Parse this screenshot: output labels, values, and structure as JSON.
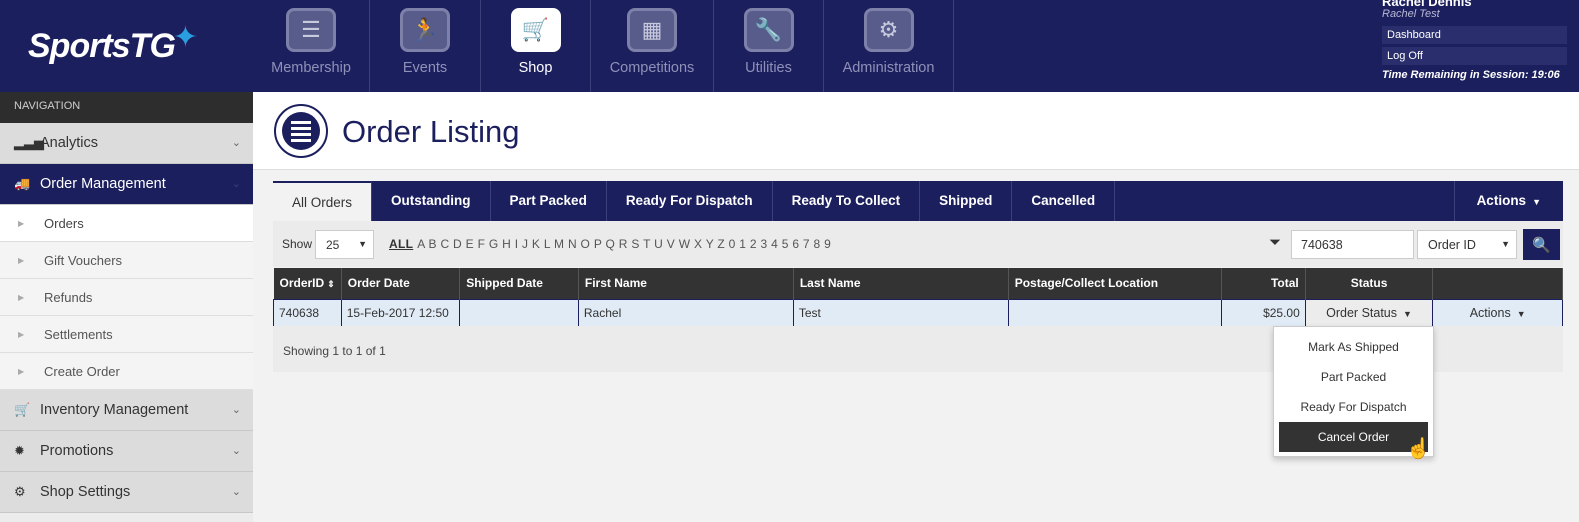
{
  "header": {
    "logo": "SportsTG",
    "modules": [
      {
        "label": "Membership",
        "icon": "clipboard-icon",
        "glyph": "☰",
        "active": false,
        "width": 117
      },
      {
        "label": "Events",
        "icon": "runner-icon",
        "glyph": "🏃",
        "active": false,
        "width": 111
      },
      {
        "label": "Shop",
        "icon": "cart-icon",
        "glyph": "🛒",
        "active": true,
        "width": 110
      },
      {
        "label": "Competitions",
        "icon": "podium-icon",
        "glyph": "▦",
        "active": false,
        "width": 123
      },
      {
        "label": "Utilities",
        "icon": "wrench-icon",
        "glyph": "🔧",
        "active": false,
        "width": 110
      },
      {
        "label": "Administration",
        "icon": "gear-icon",
        "glyph": "⚙",
        "active": false,
        "width": 130
      }
    ],
    "user": {
      "name": "Rachel Dennis",
      "sub": "Rachel Test",
      "links": [
        "Dashboard",
        "Log Off"
      ],
      "session": "Time Remaining in Session: 19:06"
    }
  },
  "sidebar": {
    "title": "NAVIGATION",
    "sections": [
      {
        "label": "Analytics",
        "icon": "bar-chart-icon",
        "glyph": "▂▃▅",
        "open": false
      },
      {
        "label": "Order Management",
        "icon": "truck-icon",
        "glyph": "🚚",
        "open": true,
        "items": [
          {
            "label": "Orders",
            "active": true
          },
          {
            "label": "Gift Vouchers",
            "active": false
          },
          {
            "label": "Refunds",
            "active": false
          },
          {
            "label": "Settlements",
            "active": false
          },
          {
            "label": "Create Order",
            "active": false
          }
        ]
      },
      {
        "label": "Inventory Management",
        "icon": "cart-icon",
        "glyph": "🛒",
        "open": false
      },
      {
        "label": "Promotions",
        "icon": "badge-icon",
        "glyph": "✹",
        "open": false
      },
      {
        "label": "Shop Settings",
        "icon": "cogs-icon",
        "glyph": "⚙",
        "open": false
      }
    ]
  },
  "page": {
    "title": "Order Listing"
  },
  "tabs": [
    "All Orders",
    "Outstanding",
    "Part Packed",
    "Ready For Dispatch",
    "Ready To Collect",
    "Shipped",
    "Cancelled"
  ],
  "tabs_active": "All Orders",
  "tabs_actions": "Actions",
  "filter": {
    "show_label": "Show",
    "show_value": "25",
    "letters_all": "ALL",
    "letters": "A B C D E F G H I J K L M N O P Q R S T U V W X Y Z 0 1 2 3 4 5 6 7 8 9",
    "search_value": "740638",
    "search_field": "Order ID"
  },
  "table": {
    "columns": [
      "OrderID",
      "Order Date",
      "Shipped Date",
      "First Name",
      "Last Name",
      "Postage/Collect Location",
      "Total",
      "Status",
      ""
    ],
    "rows": [
      {
        "order_id": "740638",
        "order_date": "15-Feb-2017 12:50",
        "shipped_date": "",
        "first_name": "Rachel",
        "last_name": "Test",
        "location": "",
        "total": "$25.00",
        "status": "Order Status",
        "actions": "Actions"
      }
    ]
  },
  "showing": "Showing 1 to 1 of 1",
  "status_menu": [
    "Mark As Shipped",
    "Part Packed",
    "Ready For Dispatch",
    "Cancel Order"
  ],
  "status_menu_hover": "Cancel Order",
  "colors": {
    "brand": "#1c1f5e",
    "accent": "#2a9fe0",
    "dark": "#333333"
  }
}
